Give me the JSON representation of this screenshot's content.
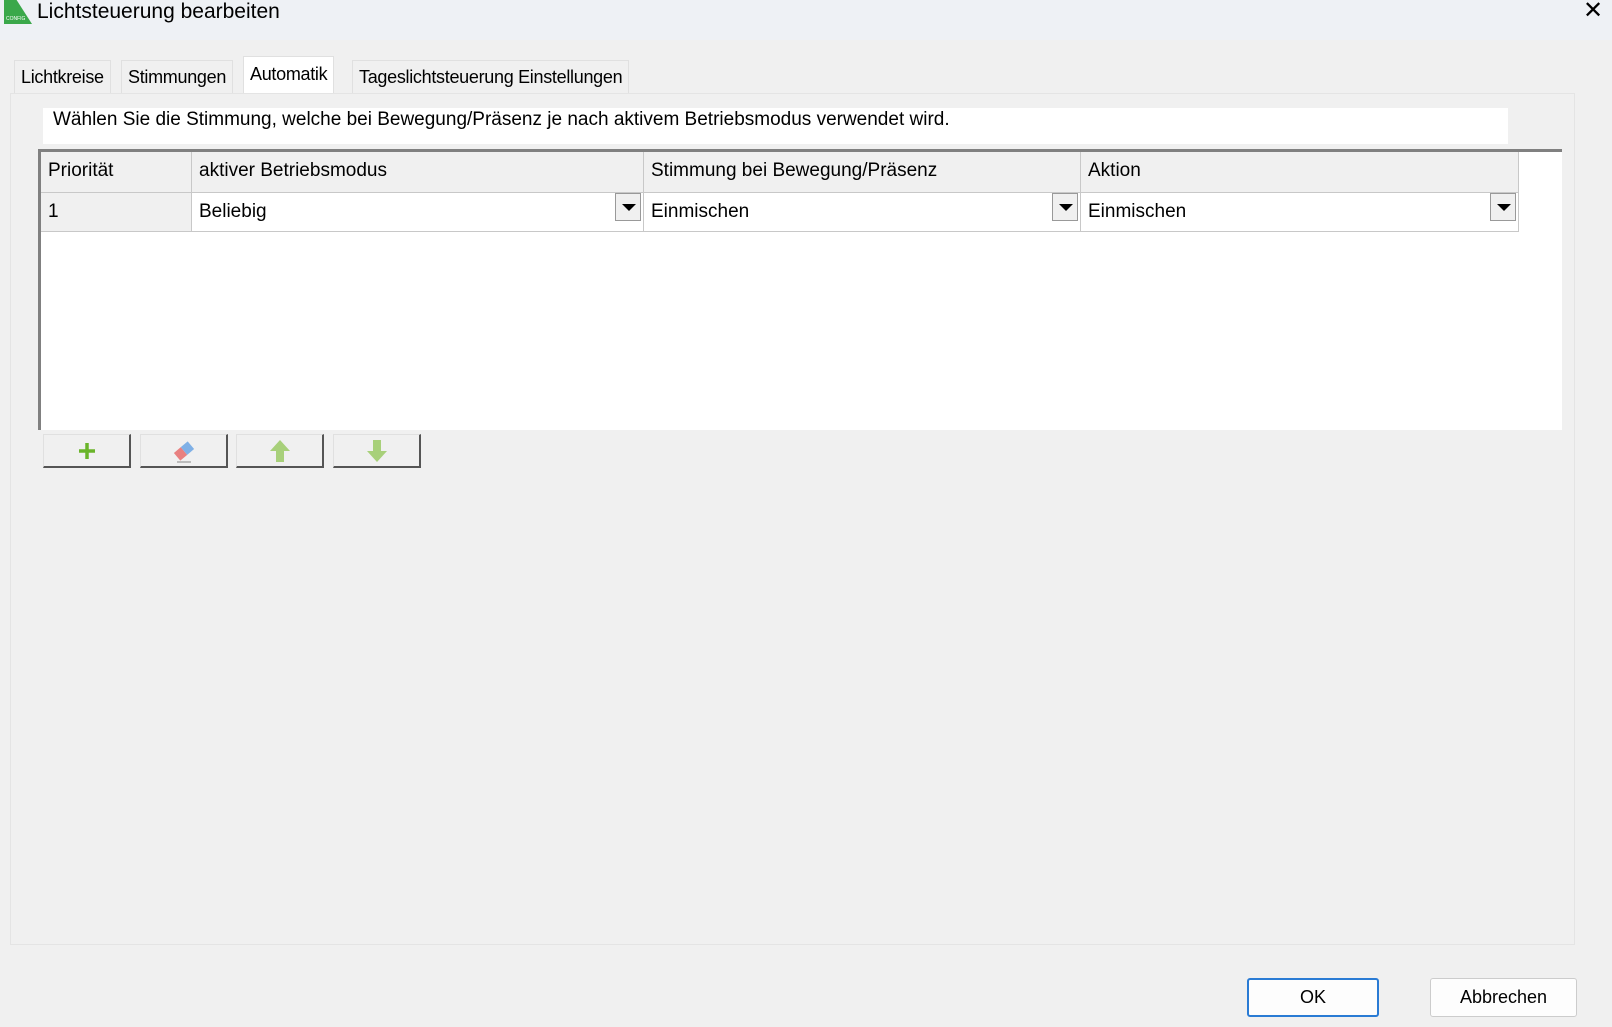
{
  "window": {
    "title": "Lichtsteuerung bearbeiten",
    "icon_label": "CONFIG"
  },
  "tabs": [
    {
      "label": "Lichtkreise"
    },
    {
      "label": "Stimmungen"
    },
    {
      "label": "Automatik",
      "active": true
    },
    {
      "label": "Tageslichtsteuerung Einstellungen"
    }
  ],
  "instruction": "Wählen Sie die Stimmung, welche bei Bewegung/Präsenz je nach aktivem Betriebsmodus verwendet wird.",
  "table": {
    "columns": [
      "Priorität",
      "aktiver Betriebsmodus",
      "Stimmung bei Bewegung/Präsenz",
      "Aktion"
    ],
    "rows": [
      {
        "prioritaet": "1",
        "betriebsmodus": "Beliebig",
        "stimmung": "Einmischen",
        "aktion": "Einmischen"
      }
    ]
  },
  "toolbar": [
    "add",
    "delete",
    "move-up",
    "move-down"
  ],
  "buttons": {
    "ok": "OK",
    "cancel": "Abbrechen"
  },
  "colors": {
    "accent": "#2a7bd4",
    "icon_green": "#6ab42a"
  }
}
